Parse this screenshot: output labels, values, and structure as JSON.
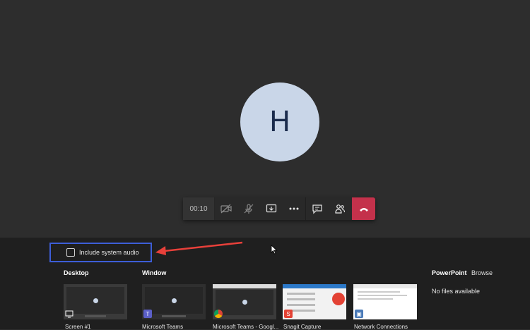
{
  "call": {
    "avatar_initial": "H",
    "timer": "00:10"
  },
  "controls": {
    "icons": [
      "video-off-icon",
      "mic-off-icon",
      "share-screen-icon",
      "more-options-icon",
      "chat-icon",
      "participants-icon",
      "hang-up-icon"
    ],
    "hangup_color": "#c4314b"
  },
  "share": {
    "include_audio_label": "Include system audio",
    "include_audio_checked": false,
    "desktop_title": "Desktop",
    "window_title": "Window",
    "powerpoint_title": "PowerPoint",
    "browse_label": "Browse",
    "no_files": "No files available",
    "desktop_items": [
      {
        "label": "Screen #1"
      }
    ],
    "window_items": [
      {
        "label": "Microsoft Teams"
      },
      {
        "label": "Microsoft Teams - Googl..."
      },
      {
        "label": "Snagit Capture"
      },
      {
        "label": "Network Connections"
      }
    ]
  },
  "accent": {
    "highlight_border": "#3d5ed8",
    "arrow": "#e8403a"
  }
}
